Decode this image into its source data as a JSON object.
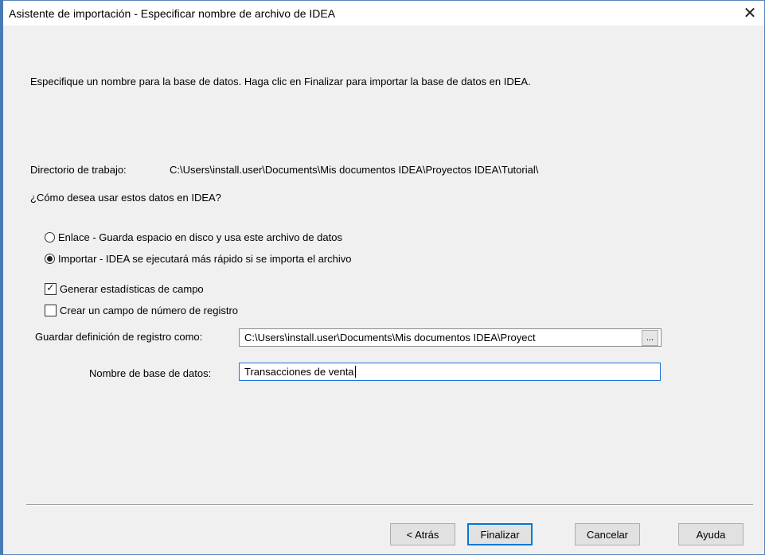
{
  "window": {
    "title": "Asistente de importación - Especificar nombre de archivo de IDEA",
    "close_glyph": "✕"
  },
  "instructions": "Especifique un nombre para la base de datos. Haga clic en Finalizar para importar la base de datos en IDEA.",
  "working_dir": {
    "label": "Directorio de trabajo:",
    "value": "C:\\Users\\install.user\\Documents\\Mis documentos IDEA\\Proyectos IDEA\\Tutorial\\"
  },
  "question": "¿Cómo desea usar estos datos en IDEA?",
  "options": {
    "link": {
      "label": "Enlace - Guarda espacio en disco y usa este archivo de datos",
      "selected": false
    },
    "import": {
      "label": "Importar - IDEA se ejecutará más rápido si se importa el archivo",
      "selected": true
    }
  },
  "checkboxes": {
    "stats": {
      "label": "Generar estadísticas de campo",
      "checked": true
    },
    "record_number": {
      "label": "Crear un campo de número de registro",
      "checked": false
    }
  },
  "save_definition": {
    "label": "Guardar definición de registro como:",
    "value": "C:\\Users\\install.user\\Documents\\Mis documentos IDEA\\Proyect",
    "browse_label": "..."
  },
  "database_name": {
    "label": "Nombre de base de datos:",
    "value": "Transacciones de venta"
  },
  "buttons": {
    "back": "< Atrás",
    "finish": "Finalizar",
    "cancel": "Cancelar",
    "help": "Ayuda"
  }
}
